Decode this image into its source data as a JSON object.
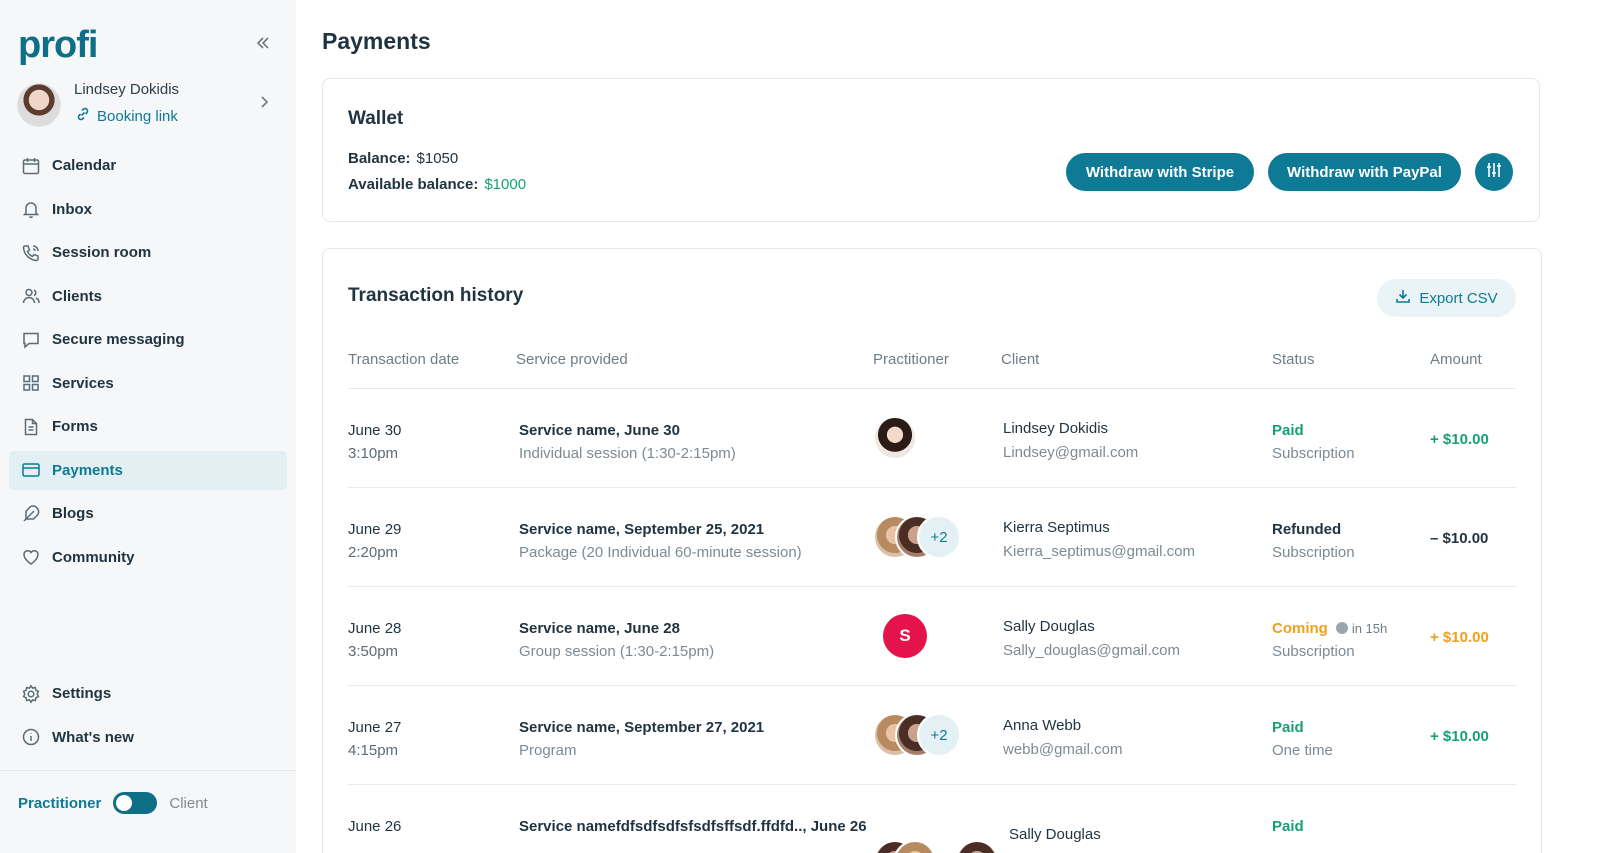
{
  "app": {
    "logo": "profi",
    "page_title": "Payments"
  },
  "profile": {
    "name": "Lindsey Dokidis",
    "booking_link": "Booking link"
  },
  "nav": [
    {
      "label": "Calendar",
      "icon": "calendar-icon"
    },
    {
      "label": "Inbox",
      "icon": "bell-icon"
    },
    {
      "label": "Session room",
      "icon": "phone-icon"
    },
    {
      "label": "Clients",
      "icon": "users-icon"
    },
    {
      "label": "Secure messaging",
      "icon": "chat-icon"
    },
    {
      "label": "Services",
      "icon": "grid-icon"
    },
    {
      "label": "Forms",
      "icon": "document-icon"
    },
    {
      "label": "Payments",
      "icon": "card-icon",
      "active": true
    },
    {
      "label": "Blogs",
      "icon": "feather-icon"
    },
    {
      "label": "Community",
      "icon": "heart-icon"
    }
  ],
  "nav_bottom": [
    {
      "label": "Settings",
      "icon": "gear-icon"
    },
    {
      "label": "What's new",
      "icon": "info-icon"
    }
  ],
  "role": {
    "practitioner": "Practitioner",
    "client": "Client"
  },
  "wallet": {
    "title": "Wallet",
    "balance_label": "Balance:",
    "balance_value": "$1050",
    "available_label": "Available balance:",
    "available_value": "$1000",
    "stripe_button": "Withdraw with Stripe",
    "paypal_button": "Withdraw with PayPal"
  },
  "history": {
    "title": "Transaction history",
    "export_label": "Export CSV",
    "columns": [
      "Transaction date",
      "Service provided",
      "Practitioner",
      "Client",
      "Status",
      "Amount"
    ],
    "rows": [
      {
        "date": "June 30",
        "time": "3:10pm",
        "service": "Service name, June 30",
        "detail": "Individual session (1:30-2:15pm)",
        "client": "Lindsey Dokidis",
        "email": "Lindsey@gmail.com",
        "status": "Paid",
        "status_sub": "Subscription",
        "amount": "+ $10.00"
      },
      {
        "date": "June 29",
        "time": "2:20pm",
        "service": "Service name, September 25, 2021",
        "detail": "Package (20 Individual 60-minute session)",
        "more": "+2",
        "client": "Kierra Septimus",
        "email": "Kierra_septimus@gmail.com",
        "status": "Refunded",
        "status_sub": "Subscription",
        "amount": "– $10.00"
      },
      {
        "date": "June 28",
        "time": "3:50pm",
        "service": "Service name, June 28",
        "detail": "Group session (1:30-2:15pm)",
        "initial": "S",
        "client": "Sally Douglas",
        "email": "Sally_douglas@gmail.com",
        "status": "Coming",
        "status_eta": "in 15h",
        "status_sub": "Subscription",
        "amount": "+ $10.00"
      },
      {
        "date": "June 27",
        "time": "4:15pm",
        "service": "Service name, September 27, 2021",
        "detail": "Program",
        "more": "+2",
        "client": "Anna Webb",
        "email": "webb@gmail.com",
        "status": "Paid",
        "status_sub": "One time",
        "amount": "+ $10.00"
      },
      {
        "date": "June 26",
        "service": "Service namefdfsdfsdfsfsdfsffsdf.ffdfd.., June 26",
        "client": "Sally Douglas",
        "status": "Paid"
      }
    ]
  }
}
